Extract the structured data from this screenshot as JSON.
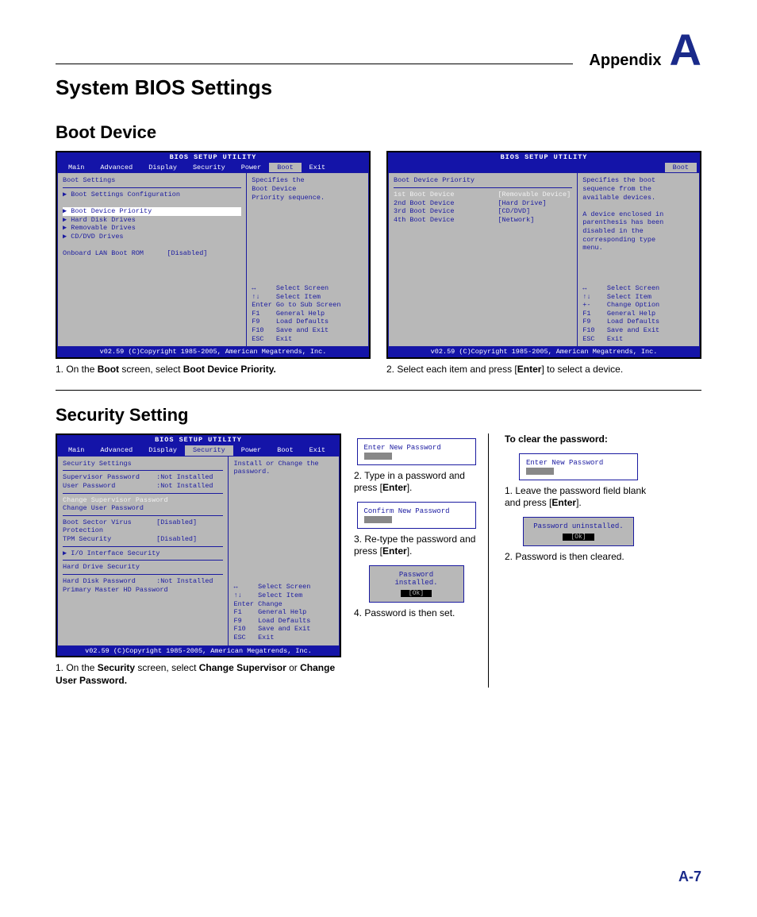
{
  "header": {
    "appendix_label": "Appendix",
    "appendix_letter": "A"
  },
  "page_title": "System BIOS Settings",
  "page_number": "A-7",
  "boot_section": {
    "heading": "Boot Device",
    "left_bios": {
      "title": "BIOS SETUP UTILITY",
      "menu": [
        "Main",
        "Advanced",
        "Display",
        "Security",
        "Power",
        "Boot",
        "Exit"
      ],
      "menu_selected": "Boot",
      "panel_title": "Boot Settings",
      "items": [
        "▶ Boot Settings Configuration",
        "",
        "▶ Boot Device Priority",
        "▶ Hard Disk Drives",
        "▶ Removable Drives",
        "▶ CD/DVD Drives"
      ],
      "selected_item": "▶ Boot Device Priority",
      "extra_row": {
        "label": "Onboard LAN Boot ROM",
        "value": "[Disabled]"
      },
      "help": "Specifies the\nBoot Device\nPriority sequence.",
      "keys": [
        "↔     Select Screen",
        "↑↓    Select Item",
        "Enter Go to Sub Screen",
        "F1    General Help",
        "F9    Load Defaults",
        "F10   Save and Exit",
        "ESC   Exit"
      ],
      "footer": "v02.59 (C)Copyright 1985-2005, American Megatrends, Inc."
    },
    "left_caption_pre": "1. On the ",
    "left_caption_b1": "Boot",
    "left_caption_mid": " screen, select ",
    "left_caption_b2": "Boot Device Priority.",
    "right_bios": {
      "title": "BIOS SETUP UTILITY",
      "menu_single": "Boot",
      "panel_title": "Boot Device Priority",
      "rows": [
        {
          "label": "1st Boot Device",
          "value": "[Removable Device]",
          "sel": true
        },
        {
          "label": "2nd Boot Device",
          "value": "[Hard Drive]"
        },
        {
          "label": "3rd Boot Device",
          "value": "[CD/DVD]"
        },
        {
          "label": "4th Boot Device",
          "value": "[Network]"
        }
      ],
      "help": "Specifies the boot\nsequence from the\navailable devices.\n\nA device enclosed in\nparenthesis has been\ndisabled in the\ncorresponding type\nmenu.",
      "keys": [
        "↔     Select Screen",
        "↑↓    Select Item",
        "+-    Change Option",
        "F1    General Help",
        "F9    Load Defaults",
        "F10   Save and Exit",
        "ESC   Exit"
      ],
      "footer": "v02.59 (C)Copyright 1985-2005, American Megatrends, Inc."
    },
    "right_caption_pre": "2. Select each item and press [",
    "right_caption_b": "Enter",
    "right_caption_post": "] to select a device."
  },
  "security_section": {
    "heading": "Security Setting",
    "bios": {
      "title": "BIOS SETUP UTILITY",
      "menu": [
        "Main",
        "Advanced",
        "Display",
        "Security",
        "Power",
        "Boot",
        "Exit"
      ],
      "menu_selected": "Security",
      "panel_title": "Security Settings",
      "status_rows": [
        {
          "label": "Supervisor Password",
          "value": ":Not Installed"
        },
        {
          "label": "User Password",
          "value": ":Not Installed"
        }
      ],
      "change_rows": [
        "Change Supervisor Password",
        "Change User Password"
      ],
      "selected_change": "Change Supervisor Password",
      "opt_rows": [
        {
          "label": "Boot Sector Virus Protection",
          "value": "[Disabled]"
        },
        {
          "label": "TPM Security",
          "value": "[Disabled]"
        }
      ],
      "io_row": "▶ I/O Interface Security",
      "hd_title": "Hard Drive Security",
      "hd_rows": [
        {
          "label": "Hard Disk Password",
          "value": ":Not Installed"
        },
        {
          "label": "Primary Master HD Password",
          "value": ""
        }
      ],
      "help": "Install or Change the\npassword.",
      "keys": [
        "↔     Select Screen",
        "↑↓    Select Item",
        "Enter Change",
        "F1    General Help",
        "F9    Load Defaults",
        "F10   Save and Exit",
        "ESC   Exit"
      ],
      "footer": "v02.59 (C)Copyright 1985-2005, American Megatrends, Inc."
    },
    "bios_caption_pre": "1. On the ",
    "bios_caption_b1": "Security",
    "bios_caption_mid": " screen, select ",
    "bios_caption_b2": "Change Supervisor",
    "bios_caption_mid2": " or ",
    "bios_caption_b3": "Change User Password.",
    "mid": {
      "dlg1": "Enter New Password",
      "cap1_pre": "2. Type in a password and press [",
      "cap1_b": "Enter",
      "cap1_post": "].",
      "dlg2": "Confirm New Password",
      "cap2_pre": "3. Re-type the password and press [",
      "cap2_b": "Enter",
      "cap2_post": "].",
      "dlg3": "Password installed.",
      "dlg3_btn": "[Ok]",
      "cap3": "4. Password is then set."
    },
    "right": {
      "heading": "To clear the password:",
      "dlg1": "Enter New Password",
      "cap1_pre": "1. Leave the password field blank and press [",
      "cap1_b": "Enter",
      "cap1_post": "].",
      "dlg2": "Password uninstalled.",
      "dlg2_btn": "[Ok]",
      "cap2": "2. Password is then cleared."
    }
  }
}
